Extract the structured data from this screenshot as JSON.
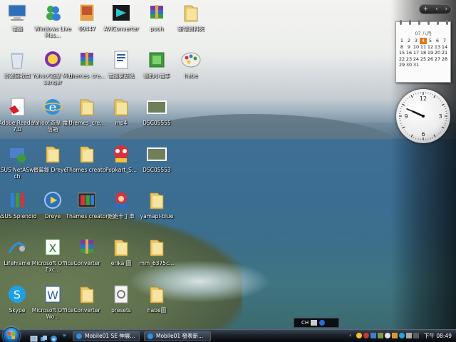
{
  "desktop": {
    "icons": [
      {
        "label": "電腦",
        "icon": "computer-icon"
      },
      {
        "label": "Windows Live Mes...",
        "icon": "live-messenger-icon"
      },
      {
        "label": "09447",
        "icon": "image-file-icon"
      },
      {
        "label": "AVIConverter",
        "icon": "aviconverter-icon"
      },
      {
        "label": "pooh",
        "icon": "winrar-icon"
      },
      {
        "label": "新增資料夾",
        "icon": "folder-icon"
      },
      {
        "label": "資源回收筒",
        "icon": "recycle-bin-icon"
      },
      {
        "label": "Yahoo!奇摩 Messenger",
        "icon": "yahoo-messenger-icon"
      },
      {
        "label": "themes_cre...",
        "icon": "winrar-icon"
      },
      {
        "label": "電腦更新法",
        "icon": "word-document-icon"
      },
      {
        "label": "摳的小電手",
        "icon": "green-app-icon"
      },
      {
        "label": "habe",
        "icon": "palette-icon"
      },
      {
        "label": "Adobe Reader 7.0",
        "icon": "adobe-reader-icon"
      },
      {
        "label": "Yahoo!奇摩 電子信箱",
        "icon": "internet-explorer-icon"
      },
      {
        "label": "themes_cre...",
        "icon": "folder-icon"
      },
      {
        "label": "mp4",
        "icon": "folder-icon"
      },
      {
        "label": "DSC05555",
        "icon": "photo-icon"
      },
      {
        "label": "ASUS NetASwitch",
        "icon": "asus-switch-icon"
      },
      {
        "label": "螢幕錄 Dreye 7",
        "icon": "folder-icon"
      },
      {
        "label": "Thames creator",
        "icon": "folder-icon"
      },
      {
        "label": "Popkart_S...",
        "icon": "popkart-icon"
      },
      {
        "label": "DSC05553",
        "icon": "photo-icon"
      },
      {
        "label": "ASUS Splendid",
        "icon": "asus-splendid-icon"
      },
      {
        "label": "Dreye",
        "icon": "dreye-icon"
      },
      {
        "label": "Thames creator",
        "icon": "themes-creator-icon"
      },
      {
        "label": "跑跑卡丁車",
        "icon": "kartrider-icon"
      },
      {
        "label": "yamapi-blue",
        "icon": "folder-icon"
      },
      {
        "label": "LifeFrame",
        "icon": "lifeframe-icon"
      },
      {
        "label": "Microsoft Office Exc...",
        "icon": "excel-icon"
      },
      {
        "label": "Converter",
        "icon": "winrar-icon"
      },
      {
        "label": "erika 圖",
        "icon": "folder-icon"
      },
      {
        "label": "mm_6375c...",
        "icon": "folder-icon"
      },
      {
        "label": "Skype",
        "icon": "skype-icon"
      },
      {
        "label": "Microsoft Office Wo...",
        "icon": "word-icon"
      },
      {
        "label": "Converter",
        "icon": "folder-icon"
      },
      {
        "label": "presets",
        "icon": "settings-file-icon"
      },
      {
        "label": "habe圖",
        "icon": "folder-icon"
      }
    ]
  },
  "sidebar": {
    "controls": [
      "+",
      "‹",
      "›"
    ],
    "calendar": {
      "title": "07 八月",
      "days": [
        "",
        "",
        "",
        "",
        "",
        "",
        "",
        "1",
        "2",
        "3",
        "4",
        "5",
        "6",
        "7",
        "8",
        "9",
        "10",
        "11",
        "12",
        "13",
        "14",
        "15",
        "16",
        "17",
        "18",
        "19",
        "20",
        "21",
        "22",
        "23",
        "24",
        "25",
        "26",
        "27",
        "28",
        "29",
        "30",
        "31",
        ""
      ],
      "today": "4"
    },
    "clock": {
      "hour": 9,
      "minute": 49
    }
  },
  "langbar": {
    "text": "CH"
  },
  "taskbar": {
    "buttons": [
      {
        "label": "Mobile01 SE 伸展...",
        "icon": "ie-icon"
      },
      {
        "label": "Mobile01 發表新...",
        "icon": "ie-icon"
      }
    ],
    "time": "下午 08:49"
  }
}
